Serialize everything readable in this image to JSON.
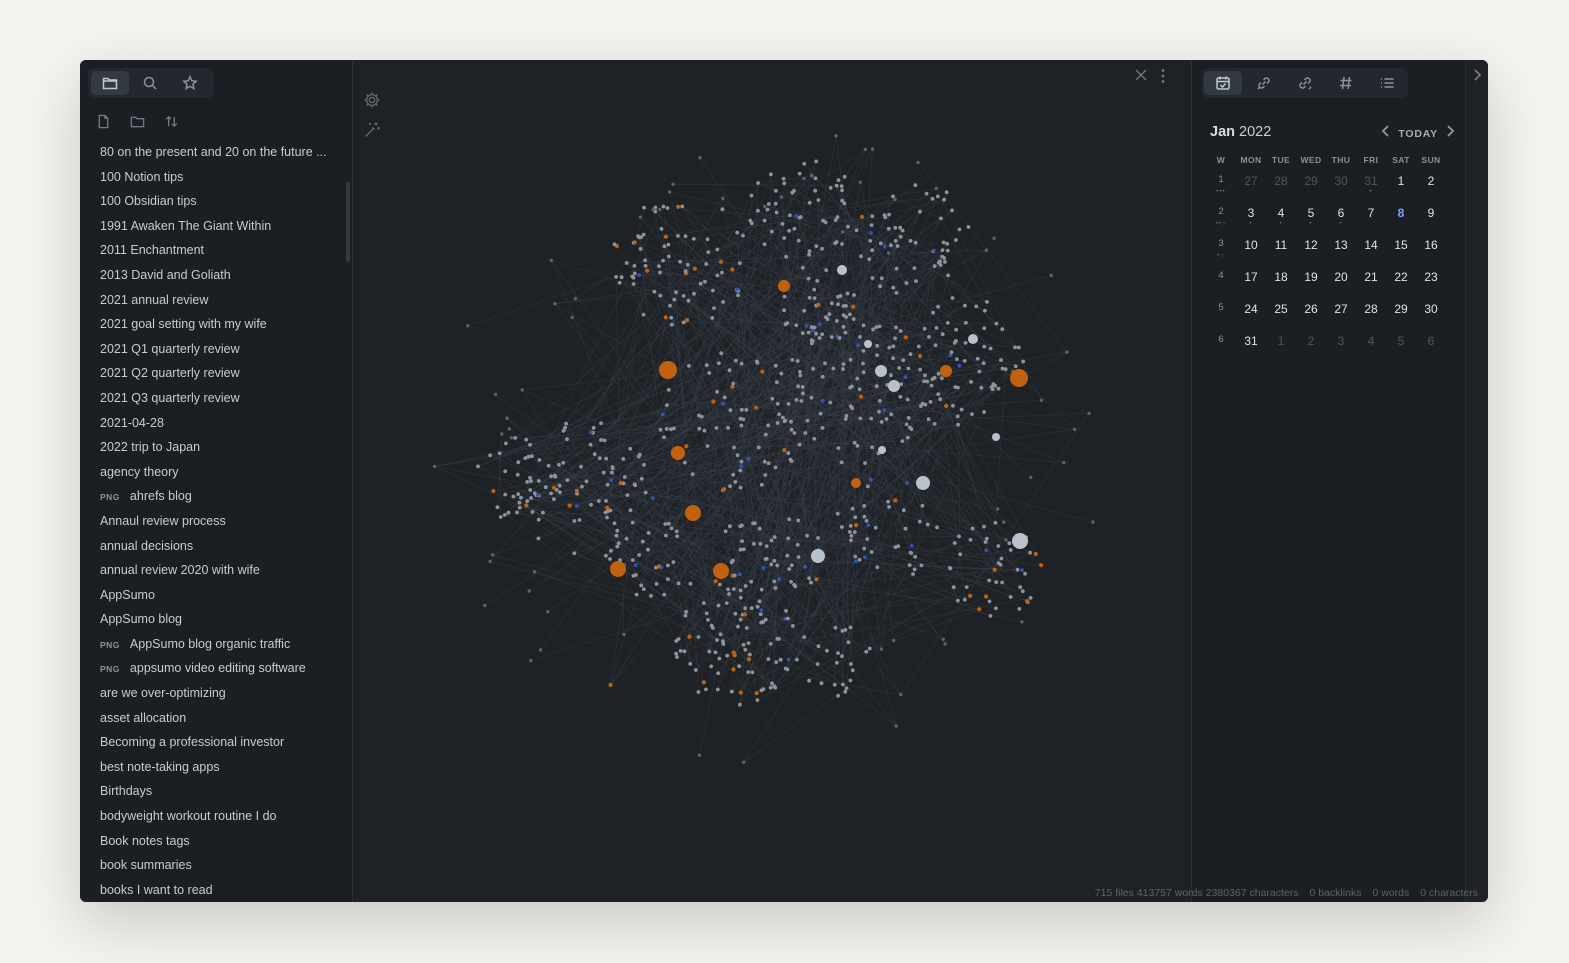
{
  "left_sidebar": {
    "files": [
      {
        "name": "80 on the present and 20 on the future ..."
      },
      {
        "name": "100 Notion tips"
      },
      {
        "name": "100 Obsidian tips"
      },
      {
        "name": "1991 Awaken The Giant Within"
      },
      {
        "name": "2011 Enchantment"
      },
      {
        "name": "2013 David and Goliath"
      },
      {
        "name": "2021 annual review"
      },
      {
        "name": "2021 goal setting with my wife"
      },
      {
        "name": "2021 Q1 quarterly review"
      },
      {
        "name": "2021 Q2 quarterly review"
      },
      {
        "name": "2021 Q3 quarterly review"
      },
      {
        "name": "2021-04-28"
      },
      {
        "name": "2022 trip to Japan"
      },
      {
        "name": "agency theory"
      },
      {
        "name": "ahrefs blog",
        "badge": "PNG"
      },
      {
        "name": "Annaul review process"
      },
      {
        "name": "annual decisions"
      },
      {
        "name": "annual review 2020 with wife"
      },
      {
        "name": "AppSumo"
      },
      {
        "name": "AppSumo blog"
      },
      {
        "name": "AppSumo blog organic traffic",
        "badge": "PNG"
      },
      {
        "name": "appsumo video editing software",
        "badge": "PNG"
      },
      {
        "name": "are we over-optimizing"
      },
      {
        "name": "asset allocation"
      },
      {
        "name": "Becoming a professional investor"
      },
      {
        "name": "best note-taking apps"
      },
      {
        "name": "Birthdays"
      },
      {
        "name": "bodyweight workout routine I do"
      },
      {
        "name": "Book notes tags"
      },
      {
        "name": "book summaries"
      },
      {
        "name": "books I want to read"
      }
    ]
  },
  "graph": {
    "colors": {
      "node": "#8e949c",
      "node_light": "#b9c2cc",
      "orange": "#c2620f",
      "blue": "#2e56b8",
      "edge": "#3a4048"
    }
  },
  "calendar": {
    "month": "Jan",
    "year": "2022",
    "today_label": "TODAY",
    "headers": [
      "W",
      "MON",
      "TUE",
      "WED",
      "THU",
      "FRI",
      "SAT",
      "SUN"
    ],
    "weeks": [
      {
        "w": "1",
        "wdots": "•••",
        "days": [
          {
            "d": "27",
            "dim": true
          },
          {
            "d": "28",
            "dim": true
          },
          {
            "d": "29",
            "dim": true
          },
          {
            "d": "30",
            "dim": true
          },
          {
            "d": "31",
            "dim": true,
            "dots": "•"
          },
          {
            "d": "1"
          },
          {
            "d": "2"
          }
        ]
      },
      {
        "w": "2",
        "wdots": "••○",
        "days": [
          {
            "d": "3",
            "dots": "•"
          },
          {
            "d": "4",
            "dots": "•"
          },
          {
            "d": "5",
            "dots": "•"
          },
          {
            "d": "6",
            "dots": "•"
          },
          {
            "d": "7"
          },
          {
            "d": "8",
            "today": true
          },
          {
            "d": "9"
          }
        ]
      },
      {
        "w": "3",
        "wdots": "•○",
        "days": [
          {
            "d": "10"
          },
          {
            "d": "11"
          },
          {
            "d": "12"
          },
          {
            "d": "13"
          },
          {
            "d": "14"
          },
          {
            "d": "15"
          },
          {
            "d": "16"
          }
        ]
      },
      {
        "w": "4",
        "days": [
          {
            "d": "17"
          },
          {
            "d": "18"
          },
          {
            "d": "19"
          },
          {
            "d": "20"
          },
          {
            "d": "21"
          },
          {
            "d": "22"
          },
          {
            "d": "23"
          }
        ]
      },
      {
        "w": "5",
        "days": [
          {
            "d": "24"
          },
          {
            "d": "25"
          },
          {
            "d": "26"
          },
          {
            "d": "27"
          },
          {
            "d": "28"
          },
          {
            "d": "29"
          },
          {
            "d": "30"
          }
        ]
      },
      {
        "w": "6",
        "days": [
          {
            "d": "31"
          },
          {
            "d": "1",
            "dim": true
          },
          {
            "d": "2",
            "dim": true
          },
          {
            "d": "3",
            "dim": true
          },
          {
            "d": "4",
            "dim": true
          },
          {
            "d": "5",
            "dim": true
          },
          {
            "d": "6",
            "dim": true
          }
        ]
      }
    ]
  },
  "status_bar": {
    "vault_stats": "715 files 413757 words 2380367 characters",
    "backlinks": "0 backlinks",
    "words": "0 words",
    "characters": "0 characters"
  }
}
